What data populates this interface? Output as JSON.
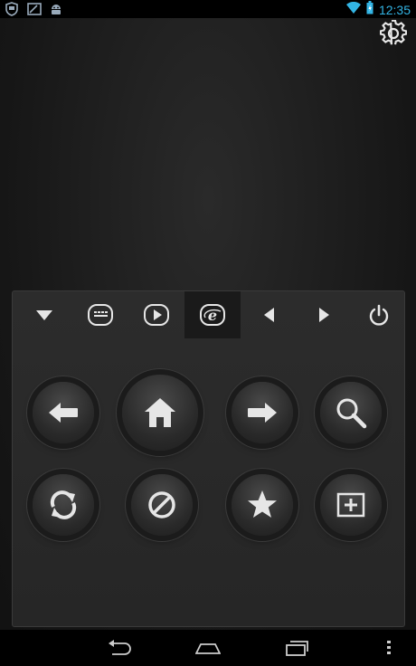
{
  "status_bar": {
    "time": "12:35",
    "notification_icons": [
      "shield-notification-icon",
      "image-notification-icon",
      "android-notification-icon"
    ],
    "system_icons": [
      "wifi-icon",
      "battery-icon"
    ]
  },
  "colors": {
    "accent": "#33b5e5",
    "icon": "#e6e6e6",
    "panel": "#2a2a2a"
  },
  "toolbar": {
    "items": [
      "collapse-icon",
      "keyboard-icon",
      "media-play-icon",
      "browser-icon",
      "arrow-left-icon",
      "arrow-right-icon",
      "power-icon"
    ],
    "active": "browser-icon"
  },
  "buttons": [
    "back",
    "home",
    "forward",
    "search",
    "refresh",
    "stop",
    "favorite",
    "new-tab"
  ]
}
